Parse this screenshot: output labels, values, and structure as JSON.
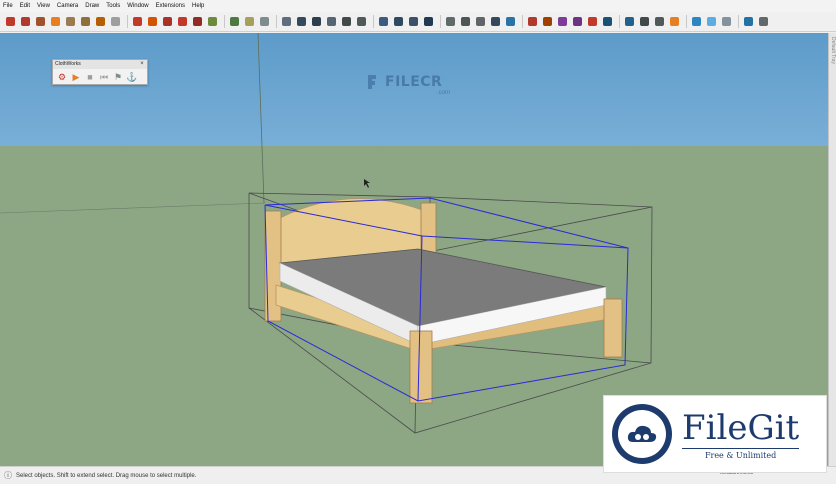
{
  "menubar": {
    "items": [
      "File",
      "Edit",
      "View",
      "Camera",
      "Draw",
      "Tools",
      "Window",
      "Extensions",
      "Help"
    ]
  },
  "toolbar": {
    "buttons": [
      {
        "name": "select-tool-icon",
        "color": "#c0392b"
      },
      {
        "name": "line-tool-icon",
        "color": "#b03a2e"
      },
      {
        "name": "arc-tool-icon",
        "color": "#a0522d"
      },
      {
        "name": "eraser-tool-icon",
        "color": "#e67e22"
      },
      {
        "name": "rectangle-tool-icon",
        "color": "#9c7a4f"
      },
      {
        "name": "circle-tool-icon",
        "color": "#8e6f3e"
      },
      {
        "name": "polygon-tool-icon",
        "color": "#b45f04"
      },
      {
        "name": "freehand-tool-icon",
        "color": "#9e9e9e"
      },
      {
        "name": "push-pull-tool-icon",
        "color": "#c0392b"
      },
      {
        "name": "move-tool-icon",
        "color": "#d35400"
      },
      {
        "name": "rotate-tool-icon",
        "color": "#a93226"
      },
      {
        "name": "scale-tool-icon",
        "color": "#c0392b"
      },
      {
        "name": "offset-tool-icon",
        "color": "#922b21"
      },
      {
        "name": "tape-measure-icon",
        "color": "#6e8b3d"
      },
      {
        "name": "dimension-tool-icon",
        "color": "#4f7942"
      },
      {
        "name": "protractor-icon",
        "color": "#a5a05a"
      },
      {
        "name": "text-tool-icon",
        "color": "#7f8c8d"
      },
      {
        "name": "axes-tool-icon",
        "color": "#5d6d7e"
      },
      {
        "name": "3d-text-icon",
        "color": "#34495e"
      },
      {
        "name": "paint-bucket-icon",
        "color": "#2c3e50"
      },
      {
        "name": "components-icon",
        "color": "#566573"
      },
      {
        "name": "warehouse-icon",
        "color": "#424949"
      },
      {
        "name": "extension-warehouse-icon",
        "color": "#515a5a"
      },
      {
        "name": "iso-view-icon",
        "color": "#3d5a80"
      },
      {
        "name": "top-view-icon",
        "color": "#2e4a62"
      },
      {
        "name": "front-view-icon",
        "color": "#3a506b"
      },
      {
        "name": "right-view-icon",
        "color": "#1f3a52"
      },
      {
        "name": "xray-style-icon",
        "color": "#5f6a6a"
      },
      {
        "name": "wireframe-style-icon",
        "color": "#4d5656"
      },
      {
        "name": "hidden-line-style-icon",
        "color": "#626567"
      },
      {
        "name": "shaded-style-icon",
        "color": "#34495e"
      },
      {
        "name": "textured-style-icon",
        "color": "#2874a6"
      },
      {
        "name": "orbit-tool-icon",
        "color": "#b03a2e"
      },
      {
        "name": "pan-tool-icon",
        "color": "#a04000"
      },
      {
        "name": "zoom-tool-icon",
        "color": "#7d3c98"
      },
      {
        "name": "zoom-window-icon",
        "color": "#6c3483"
      },
      {
        "name": "zoom-extents-icon",
        "color": "#c0392b"
      },
      {
        "name": "previous-view-icon",
        "color": "#1a5276"
      },
      {
        "name": "position-camera-icon",
        "color": "#21618c"
      },
      {
        "name": "walk-tool-icon",
        "color": "#424949"
      },
      {
        "name": "look-around-icon",
        "color": "#515a5a"
      },
      {
        "name": "section-plane-icon",
        "color": "#e67e22"
      },
      {
        "name": "section-display-icon",
        "color": "#2e86c1"
      },
      {
        "name": "section-cuts-icon",
        "color": "#5dade2"
      },
      {
        "name": "styles-icon",
        "color": "#85929e"
      },
      {
        "name": "solid-tools-icon",
        "color": "#2471a3"
      },
      {
        "name": "settings-gear-icon",
        "color": "#616a6b"
      }
    ],
    "separators_after": [
      7,
      13,
      16,
      22,
      26,
      31,
      37,
      41,
      44
    ]
  },
  "clothworks": {
    "title": "ClothWorks",
    "close_glyph": "×",
    "buttons": [
      {
        "name": "cloth-setup-icon",
        "glyph": "⚙",
        "color": "#c0392b"
      },
      {
        "name": "play-simulation-icon",
        "glyph": "▶",
        "color": "#e67e22"
      },
      {
        "name": "stop-simulation-icon",
        "glyph": "■",
        "color": "#9e9e9e"
      },
      {
        "name": "reset-simulation-icon",
        "glyph": "⏮",
        "color": "#9e9e9e"
      },
      {
        "name": "pin-vertices-icon",
        "glyph": "⚑",
        "color": "#7f8c8d"
      },
      {
        "name": "cloth-properties-icon",
        "glyph": "⚓",
        "color": "#e67e22"
      }
    ]
  },
  "watermark_filecr": {
    "name": "FILECR",
    "domain": ".com"
  },
  "statusbar": {
    "icon": "ⓘ",
    "text": "Select objects. Shift to extend select. Drag mouse to select multiple.",
    "measurements_label": "Measurements"
  },
  "right_strip": {
    "text": "Default Tray"
  },
  "watermark_filegit": {
    "name": "FileGit",
    "tagline": "Free & Unlimited"
  },
  "colors": {
    "sky_top": "#5d9bc9",
    "sky_bottom": "#c8e2f1",
    "ground": "#8da784",
    "bed_wood": "#e9cc8f",
    "mattress_top": "#7b7b7b",
    "mattress_side": "#ededed",
    "selection_box": "#2a2ad6"
  }
}
